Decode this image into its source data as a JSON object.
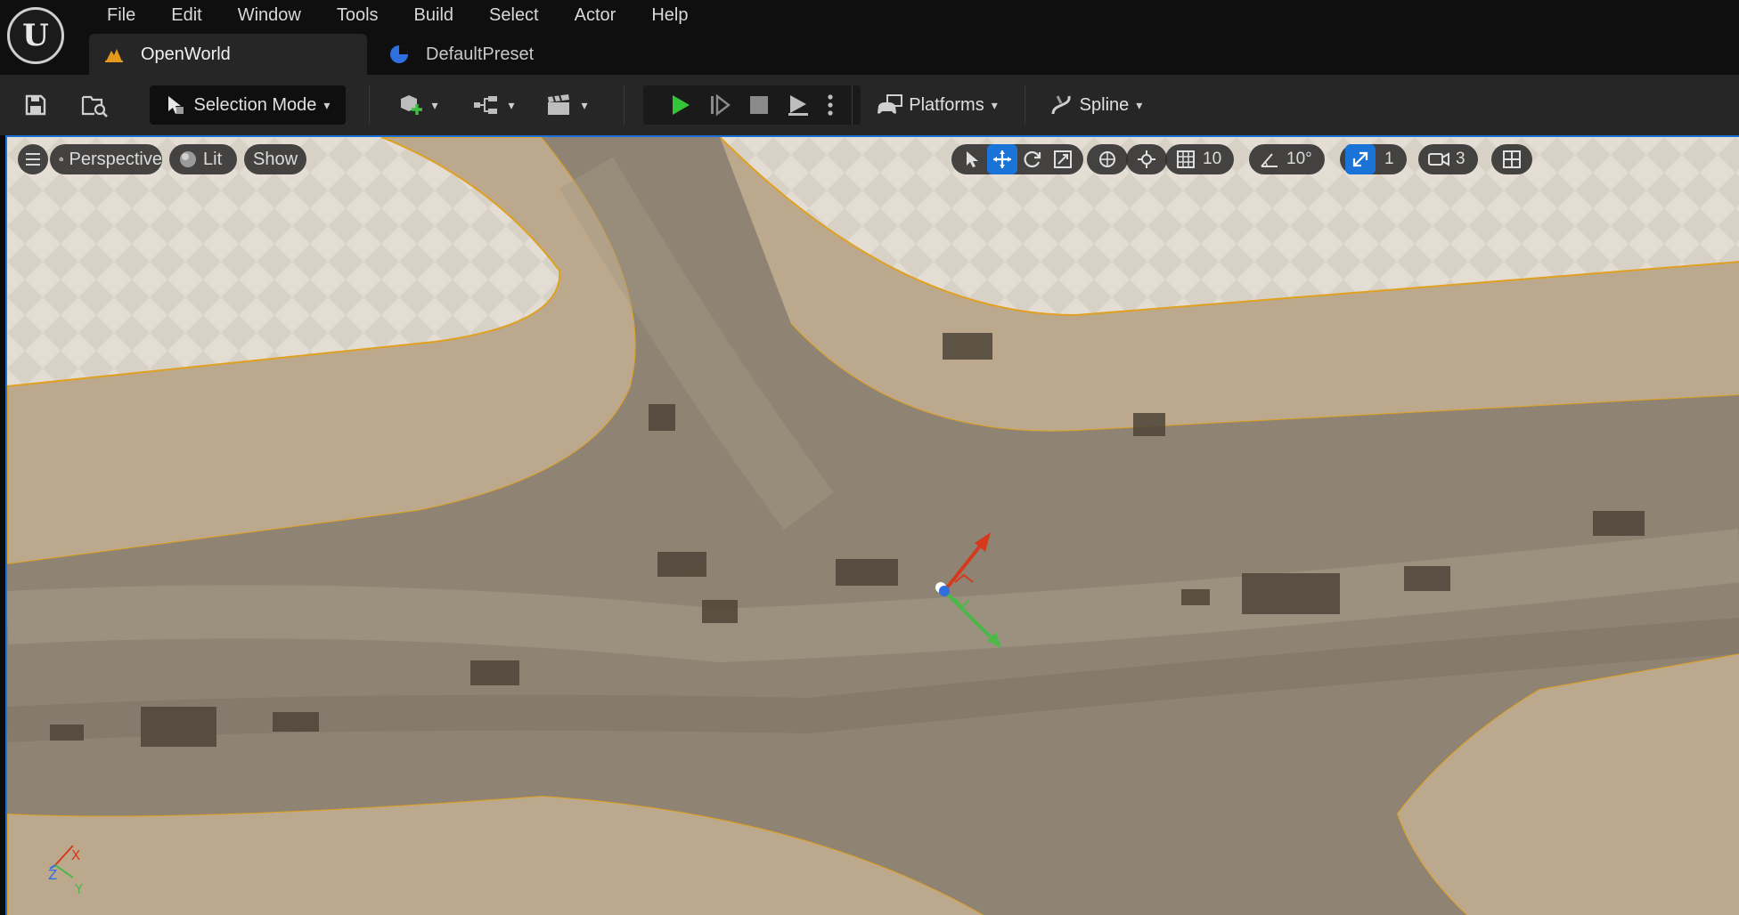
{
  "app": {
    "logo_letter": "U"
  },
  "menu": [
    "File",
    "Edit",
    "Window",
    "Tools",
    "Build",
    "Select",
    "Actor",
    "Help"
  ],
  "tabs": [
    {
      "label": "OpenWorld",
      "icon": "level-icon",
      "active": true
    },
    {
      "label": "DefaultPreset",
      "icon": "preset-icon",
      "active": false
    }
  ],
  "toolbar": {
    "selection_mode": "Selection Mode",
    "platforms": "Platforms",
    "spline": "Spline"
  },
  "viewport": {
    "perspective": "Perspective",
    "lit": "Lit",
    "show": "Show",
    "grid_snap": "10",
    "rotation_snap": "10°",
    "scale_snap": "1",
    "camera_speed": "3",
    "axis_labels": {
      "x": "X",
      "y": "Y",
      "z": "Z"
    }
  },
  "colors": {
    "accent": "#1a74d8",
    "play_green": "#33c43a",
    "spline_outline": "#e0a020",
    "gizmo_x": "#d63a1e",
    "gizmo_y": "#4cb848",
    "gizmo_z": "#2f6fe0"
  }
}
